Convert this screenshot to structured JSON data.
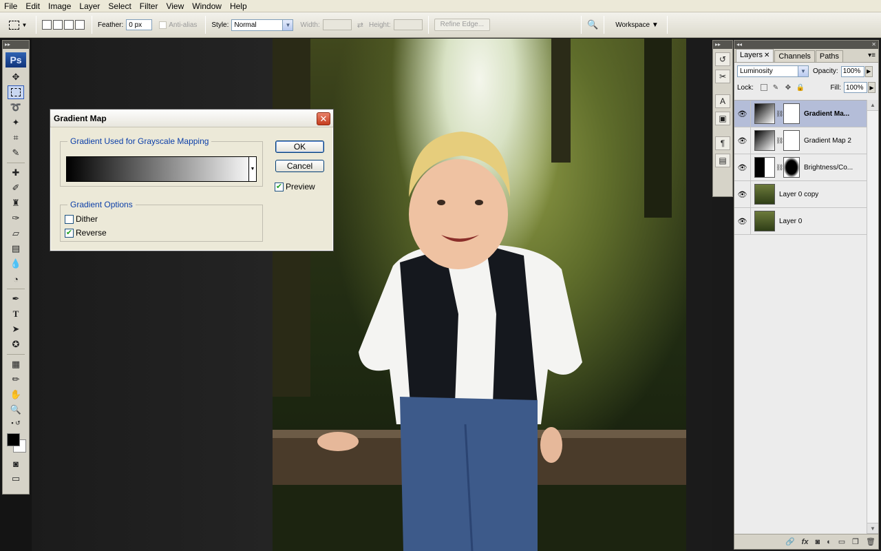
{
  "menu": [
    "File",
    "Edit",
    "Image",
    "Layer",
    "Select",
    "Filter",
    "View",
    "Window",
    "Help"
  ],
  "options": {
    "feather_label": "Feather:",
    "feather_value": "0 px",
    "antialias_label": "Anti-alias",
    "style_label": "Style:",
    "style_value": "Normal",
    "width_label": "Width:",
    "height_label": "Height:",
    "refine_edge": "Refine Edge...",
    "workspace": "Workspace"
  },
  "tools": {
    "logo": "Ps"
  },
  "dialog": {
    "title": "Gradient Map",
    "group1_title": "Gradient Used for Grayscale Mapping",
    "group2_title": "Gradient Options",
    "ok": "OK",
    "cancel": "Cancel",
    "preview": "Preview",
    "preview_checked": true,
    "dither": "Dither",
    "dither_checked": false,
    "reverse": "Reverse",
    "reverse_checked": true
  },
  "layers_panel": {
    "tabs": [
      "Layers",
      "Channels",
      "Paths"
    ],
    "blend_mode": "Luminosity",
    "opacity_label": "Opacity:",
    "opacity_value": "100%",
    "lock_label": "Lock:",
    "fill_label": "Fill:",
    "fill_value": "100%",
    "layers": [
      {
        "name": "Gradient Ma...",
        "selected": true,
        "thumb": "gradient",
        "mask": "white"
      },
      {
        "name": "Gradient Map 2",
        "selected": false,
        "thumb": "gradient",
        "mask": "white"
      },
      {
        "name": "Brightness/Co...",
        "selected": false,
        "thumb": "brightness",
        "mask": "vignette"
      },
      {
        "name": "Layer 0 copy",
        "selected": false,
        "thumb": "photo",
        "mask": null
      },
      {
        "name": "Layer 0",
        "selected": false,
        "thumb": "photo",
        "mask": null
      }
    ]
  }
}
